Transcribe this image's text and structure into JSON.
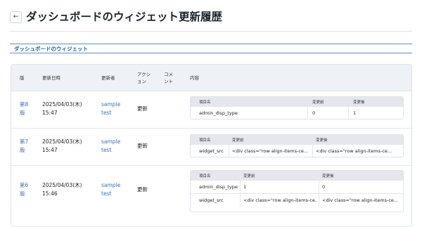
{
  "page": {
    "title": "ダッシュボードのウィジェット更新履歴",
    "back_icon": "arrow-left-icon"
  },
  "section": {
    "title": "ダッシュボードのウィジェット"
  },
  "table": {
    "headers": {
      "version": "版",
      "datetime": "更新日時",
      "updater": "更新者",
      "action": "アクション",
      "comment": "コメント",
      "content": "内容"
    },
    "rows": [
      {
        "version_line1": "第8",
        "version_line2": "版",
        "date": "2025/04/03(木)",
        "time": "15:47",
        "updater_line1": "sample",
        "updater_line2": "test",
        "action": "更新",
        "diff": {
          "headers": {
            "item": "項目名",
            "before": "変更前",
            "after": "変更後"
          },
          "lines": [
            {
              "item": "admin_disp_type",
              "before": "0",
              "after": "1"
            }
          ]
        }
      },
      {
        "version_line1": "第7",
        "version_line2": "版",
        "date": "2025/04/03(木)",
        "time": "15:47",
        "updater_line1": "sample",
        "updater_line2": "test",
        "action": "更新",
        "diff": {
          "headers": {
            "item": "項目名",
            "before": "変更前",
            "after": "変更後"
          },
          "lines": [
            {
              "item": "widget_src",
              "before": "<div class=\"row align-items-ce...",
              "after": "<div class=\"row align-items-ce..."
            }
          ]
        }
      },
      {
        "version_line1": "第6",
        "version_line2": "版",
        "date": "2025/04/03(木)",
        "time": "15:46",
        "updater_line1": "sample",
        "updater_line2": "test",
        "action": "更新",
        "diff": {
          "headers": {
            "item": "項目名",
            "before": "変更前",
            "after": "変更後"
          },
          "lines": [
            {
              "item": "admin_disp_type",
              "before": "1",
              "after": "0"
            },
            {
              "item": "widget_src",
              "before": "<div class=\"row align-items-ce...",
              "after": "<div class=\"row align-items-ce..."
            }
          ]
        }
      }
    ]
  },
  "colors": {
    "accent": "#2d62a8",
    "link": "#3a6fc0",
    "header_bg": "#eef2f6",
    "diff_header_bg": "#e4e7eb"
  }
}
